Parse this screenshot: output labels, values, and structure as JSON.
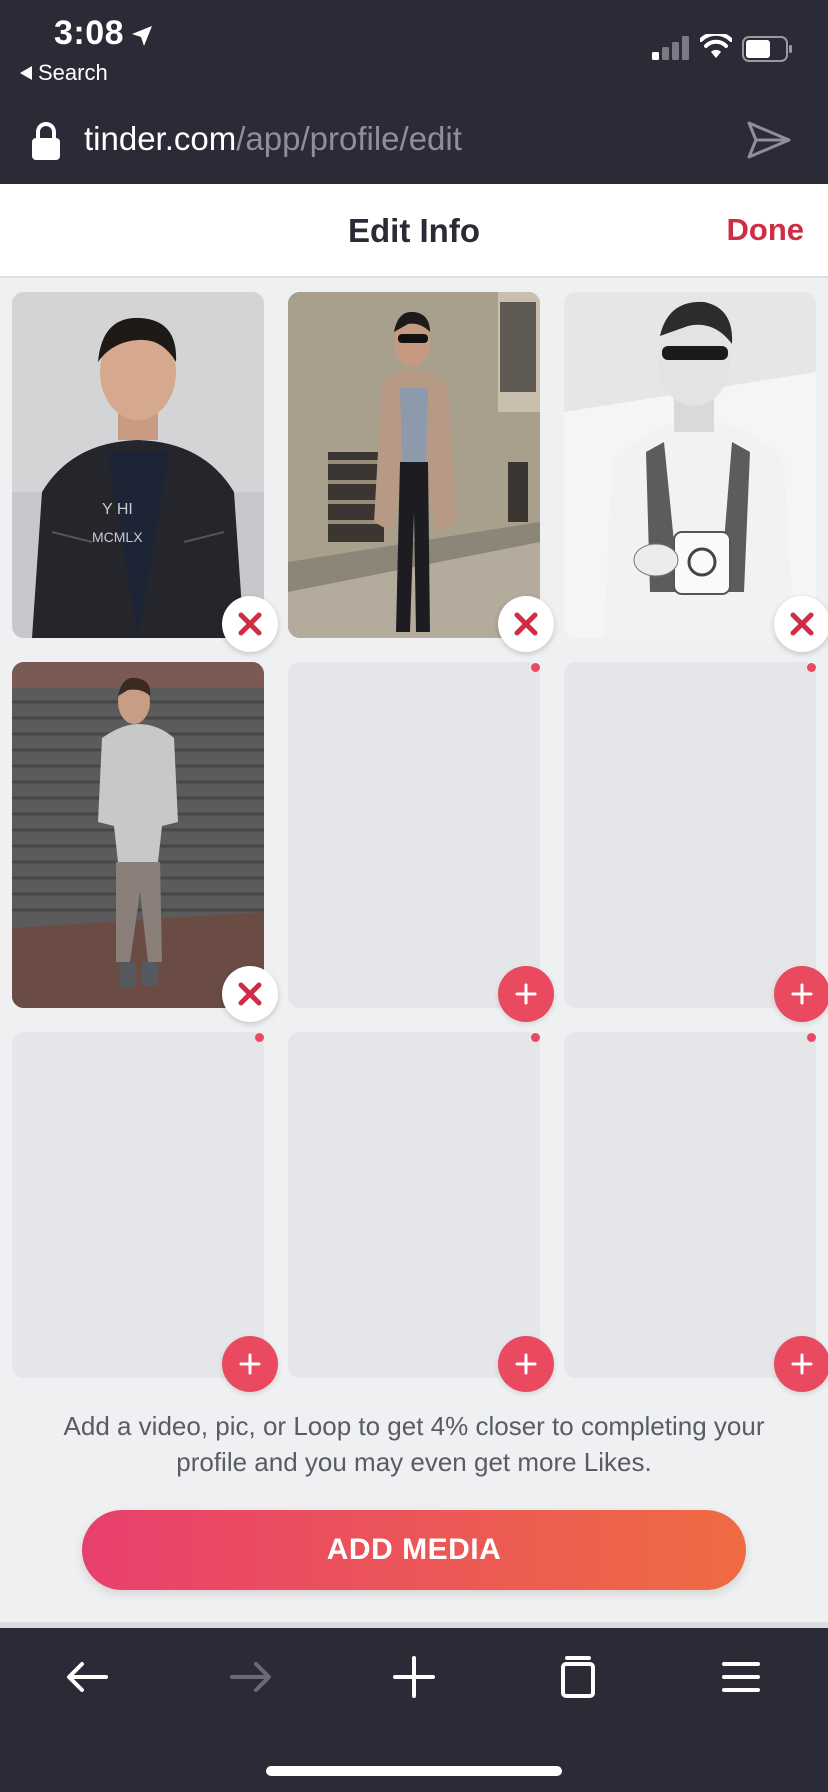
{
  "status_bar": {
    "time": "3:08",
    "back_label": "Search"
  },
  "url_bar": {
    "domain": "tinder.com",
    "path": "/app/profile/edit"
  },
  "header": {
    "title": "Edit Info",
    "done_label": "Done"
  },
  "media_grid": {
    "slots": [
      {
        "state": "photo",
        "action": "remove"
      },
      {
        "state": "photo",
        "action": "remove"
      },
      {
        "state": "photo",
        "action": "remove"
      },
      {
        "state": "photo",
        "action": "remove"
      },
      {
        "state": "empty",
        "action": "add"
      },
      {
        "state": "empty",
        "action": "add"
      },
      {
        "state": "empty",
        "action": "add"
      },
      {
        "state": "empty",
        "action": "add"
      },
      {
        "state": "empty",
        "action": "add"
      }
    ]
  },
  "hint_text": "Add a video, pic, or Loop to get 4% closer to completing your profile and you may even get more Likes.",
  "add_media_label": "ADD MEDIA",
  "toolbar": {
    "icons": [
      "back-arrow-icon",
      "forward-arrow-icon",
      "new-tab-plus-icon",
      "tabs-icon",
      "menu-icon"
    ]
  },
  "colors": {
    "brand_red": "#cf2d45",
    "button_gradient_start": "#e8406e",
    "button_gradient_end": "#ef6b42",
    "add_button": "#ea4a5f",
    "chrome_dark": "#2b2a37"
  }
}
